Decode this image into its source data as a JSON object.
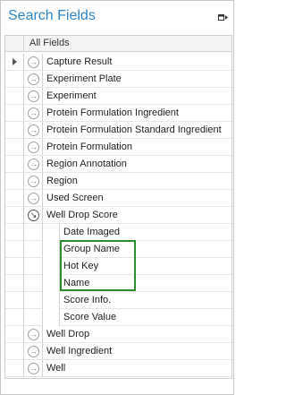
{
  "panel": {
    "title": "Search Fields",
    "pin_icon": "pin-icon"
  },
  "grid": {
    "header": "All Fields",
    "rows": [
      {
        "label": "Capture Result",
        "icon": "expand-arrow-icon"
      },
      {
        "label": "Experiment Plate",
        "icon": "expand-arrow-icon"
      },
      {
        "label": "Experiment",
        "icon": "expand-arrow-icon"
      },
      {
        "label": "Protein Formulation Ingredient",
        "icon": "expand-arrow-icon"
      },
      {
        "label": "Protein Formulation Standard Ingredient",
        "icon": "expand-arrow-icon"
      },
      {
        "label": "Protein Formulation",
        "icon": "expand-arrow-icon"
      },
      {
        "label": "Region Annotation",
        "icon": "expand-arrow-icon"
      },
      {
        "label": "Region",
        "icon": "expand-arrow-icon"
      },
      {
        "label": "Used Screen",
        "icon": "expand-arrow-icon"
      },
      {
        "label": "Well Drop Score",
        "icon": "collapse-arrow-icon"
      }
    ],
    "children": [
      {
        "label": "Date Imaged"
      },
      {
        "label": "Group Name"
      },
      {
        "label": "Hot Key"
      },
      {
        "label": "Name"
      },
      {
        "label": "Score Info."
      },
      {
        "label": "Score Value"
      }
    ],
    "rows_after": [
      {
        "label": "Well Drop",
        "icon": "expand-arrow-icon"
      },
      {
        "label": "Well Ingredient",
        "icon": "expand-arrow-icon"
      },
      {
        "label": "Well",
        "icon": "expand-arrow-icon"
      }
    ]
  },
  "colors": {
    "title": "#2d86c8",
    "highlight_border": "#2e8b2e"
  }
}
